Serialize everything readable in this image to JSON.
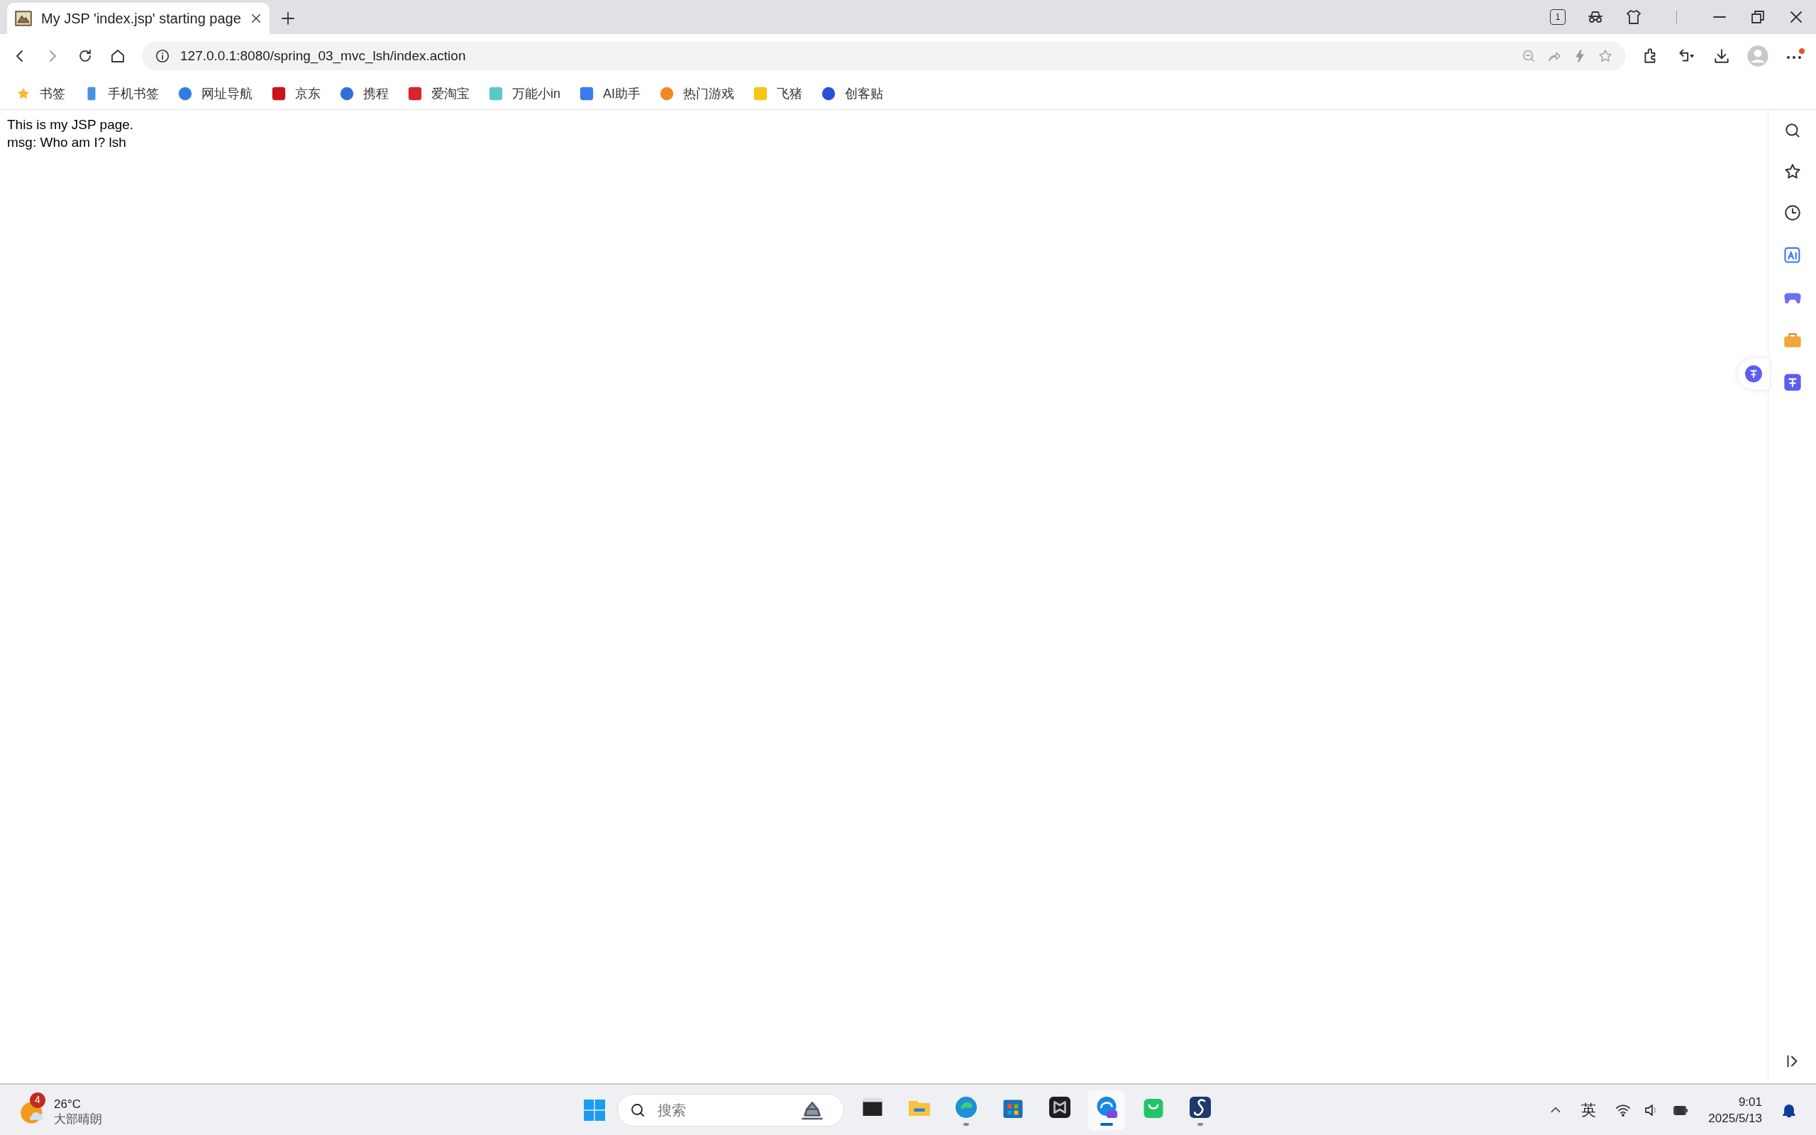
{
  "tab": {
    "title": "My JSP 'index.jsp' starting page",
    "selected": true
  },
  "address_bar": {
    "url": "127.0.0.1:8080/spring_03_mvc_lsh/index.action"
  },
  "tab_count": "1",
  "bookmarks": [
    {
      "label": "书签",
      "kind": "star",
      "color": "#f5b92e"
    },
    {
      "label": "手机书签",
      "kind": "phone",
      "color": "#4a90e2"
    },
    {
      "label": "网址导航",
      "kind": "circle",
      "color": "#2f7de1"
    },
    {
      "label": "京东",
      "kind": "square",
      "color": "#c8161d"
    },
    {
      "label": "携程",
      "kind": "circle",
      "color": "#2f6fd6"
    },
    {
      "label": "爱淘宝",
      "kind": "square",
      "color": "#d7262e"
    },
    {
      "label": "万能小in",
      "kind": "square",
      "color": "#5ac8c8"
    },
    {
      "label": "AI助手",
      "kind": "square",
      "color": "#3a7bef"
    },
    {
      "label": "热门游戏",
      "kind": "circle",
      "color": "#f08a24"
    },
    {
      "label": "飞猪",
      "kind": "square",
      "color": "#f5c518"
    },
    {
      "label": "创客贴",
      "kind": "circle",
      "color": "#2b4fd8"
    }
  ],
  "content": {
    "lines": [
      "This is my JSP page.",
      "msg: Who am I? lsh"
    ]
  },
  "taskbar": {
    "weather": {
      "temperature": "26°C",
      "condition": "大部晴朗",
      "badge": "4"
    },
    "search_placeholder": "搜索",
    "apps": [
      {
        "kind": "files",
        "running": false,
        "active": false
      },
      {
        "kind": "folder",
        "running": false,
        "active": false
      },
      {
        "kind": "edge",
        "running": true,
        "active": false
      },
      {
        "kind": "store",
        "running": false,
        "active": false
      },
      {
        "kind": "dark",
        "running": false,
        "active": false
      },
      {
        "kind": "edge-ai",
        "running": true,
        "active": true
      },
      {
        "kind": "bag",
        "running": false,
        "active": false
      },
      {
        "kind": "s-app",
        "running": true,
        "active": false
      }
    ],
    "ime": "英",
    "time": "9:01",
    "date": "2025/5/13"
  }
}
